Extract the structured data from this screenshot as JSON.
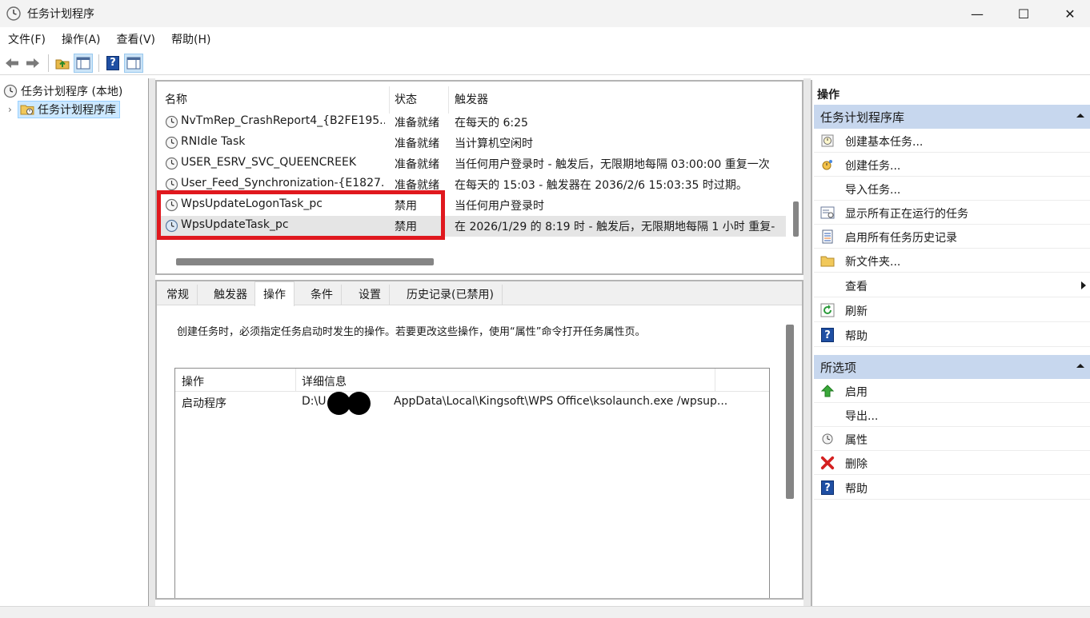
{
  "window": {
    "title": "任务计划程序",
    "minimize": "—",
    "maximize": "☐",
    "close": "✕"
  },
  "menu": [
    "文件(F)",
    "操作(A)",
    "查看(V)",
    "帮助(H)"
  ],
  "tree": {
    "root": "任务计划程序 (本地)",
    "library": "任务计划程序库",
    "expander": "›"
  },
  "task_list": {
    "columns": [
      "名称",
      "状态",
      "触发器"
    ],
    "rows": [
      {
        "name": "NvTmRep_CrashReport4_{B2FE195...",
        "status": "准备就绪",
        "trigger": "在每天的 6:25"
      },
      {
        "name": "RNIdle Task",
        "status": "准备就绪",
        "trigger": "当计算机空闲时"
      },
      {
        "name": "USER_ESRV_SVC_QUEENCREEK",
        "status": "准备就绪",
        "trigger": "当任何用户登录时 - 触发后，无限期地每隔 03:00:00 重复一次"
      },
      {
        "name": "User_Feed_Synchronization-{E1827...",
        "status": "准备就绪",
        "trigger": "在每天的 15:03 - 触发器在 2036/2/6 15:03:35 时过期。"
      },
      {
        "name": "WpsUpdateLogonTask_pc",
        "status": "禁用",
        "trigger": "当任何用户登录时"
      },
      {
        "name": "WpsUpdateTask_pc",
        "status": "禁用",
        "trigger": "在 2026/1/29 的 8:19 时 - 触发后，无限期地每隔 1 小时 重复-"
      }
    ],
    "selected_index": 5,
    "highlighted_rows": [
      4,
      5
    ]
  },
  "detail": {
    "tabs": [
      "常规",
      "触发器",
      "操作",
      "条件",
      "设置",
      "历史记录(已禁用)"
    ],
    "active_tab": 2,
    "description": "创建任务时，必须指定任务启动时发生的操作。若要更改这些操作，使用“属性”命令打开任务属性页。",
    "action_table": {
      "columns": [
        "操作",
        "详细信息"
      ],
      "rows": [
        {
          "action": "启动程序",
          "detail_prefix": "D:\\U",
          "detail_suffix": "AppData\\Local\\Kingsoft\\WPS Office\\ksolaunch.exe /wpsup..."
        }
      ]
    }
  },
  "actions_pane": {
    "title": "操作",
    "section1": {
      "title": "任务计划程序库",
      "items": [
        {
          "label": "创建基本任务...",
          "icon": "create-basic-task-icon"
        },
        {
          "label": "创建任务...",
          "icon": "create-task-icon"
        },
        {
          "label": "导入任务...",
          "icon": ""
        },
        {
          "label": "显示所有正在运行的任务",
          "icon": "running-tasks-icon"
        },
        {
          "label": "启用所有任务历史记录",
          "icon": "history-icon"
        },
        {
          "label": "新文件夹...",
          "icon": "folder-icon"
        },
        {
          "label": "查看",
          "icon": ""
        },
        {
          "label": "刷新",
          "icon": "refresh-icon"
        },
        {
          "label": "帮助",
          "icon": "help-icon"
        }
      ]
    },
    "section2": {
      "title": "所选项",
      "items": [
        {
          "label": "启用",
          "icon": "enable-arrow-icon"
        },
        {
          "label": "导出...",
          "icon": ""
        },
        {
          "label": "属性",
          "icon": "properties-icon"
        },
        {
          "label": "删除",
          "icon": "delete-icon"
        },
        {
          "label": "帮助",
          "icon": "help-icon"
        }
      ]
    }
  },
  "colors": {
    "section_header_bg": "#c7d7ee",
    "highlight_border": "#e0181e",
    "selected_row_bg": "#e5e5e5"
  }
}
